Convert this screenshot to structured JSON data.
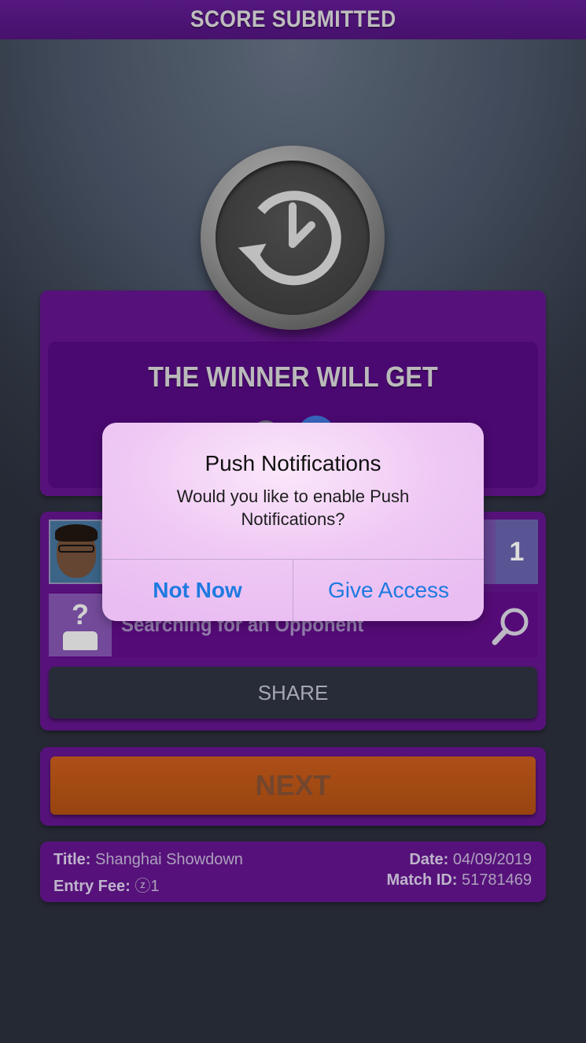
{
  "header": {
    "title": "SCORE SUBMITTED"
  },
  "prize": {
    "title": "THE WINNER WILL GET"
  },
  "player": {
    "score": "1"
  },
  "opponent": {
    "label": "Searching for an Opponent"
  },
  "share": {
    "label": "SHARE"
  },
  "next": {
    "label": "NEXT"
  },
  "match_info": {
    "title_label": "Title:",
    "title_value": "Shanghai Showdown",
    "entry_fee_label": "Entry Fee:",
    "entry_fee_value": "ⓩ1",
    "date_label": "Date:",
    "date_value": "04/09/2019",
    "match_id_label": "Match ID:",
    "match_id_value": "51781469"
  },
  "dialog": {
    "title": "Push Notifications",
    "message": "Would you like to enable Push Notifications?",
    "cancel_label": "Not Now",
    "confirm_label": "Give Access"
  },
  "icons": {
    "badge": "clock-history-icon",
    "search": "search-icon",
    "avatar": "user-avatar",
    "unknown_opponent": "unknown-user-icon"
  },
  "colors": {
    "header_bg": "#5a1a86",
    "panel_bg": "#5b1481",
    "next_btn": "#b8541a",
    "dialog_link": "#1f7ae0"
  }
}
